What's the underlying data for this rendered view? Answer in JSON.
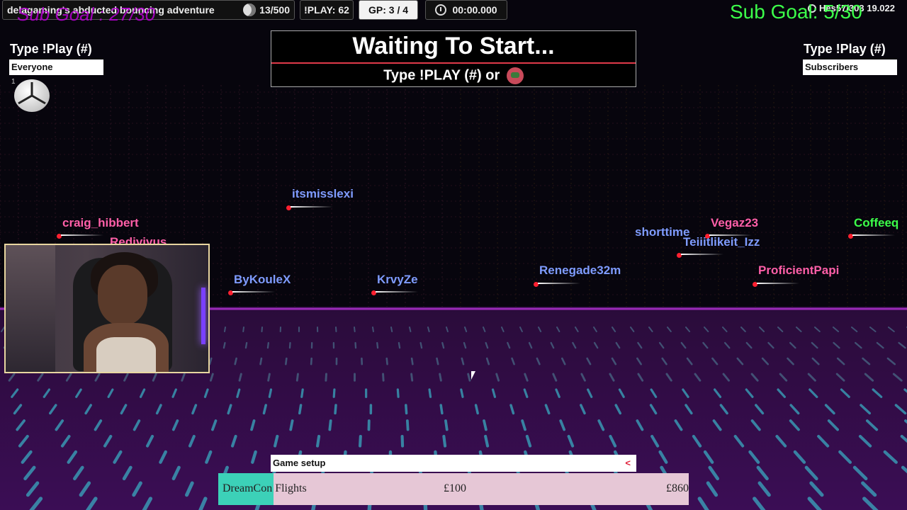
{
  "hud": {
    "title": "delagaming's abducted bouncing adventure",
    "count": "13/500",
    "play_count": "!PLAY: 62",
    "gp": "GP: 3 / 4",
    "timer": "00:00.000",
    "right_info": "Hes57/303 19.022"
  },
  "overlay": {
    "sub_goal_left": "Sub Goal : 27/30",
    "sub_goal_right": "Sub Goal: 5/30"
  },
  "left_panel": {
    "heading": "Type !Play (#)",
    "box": "Everyone",
    "slot_number": "1"
  },
  "right_panel": {
    "heading": "Type !Play (#)",
    "box": "Subscribers"
  },
  "banner": {
    "title": "Waiting To Start...",
    "subtitle": "Type !PLAY (#) or"
  },
  "players": [
    {
      "name": "itsmisslexi",
      "color": "#7f9cff"
    },
    {
      "name": "craig_hibbert",
      "color": "#ff5fa8"
    },
    {
      "name": "Redivivus",
      "color": "#ff5fa8"
    },
    {
      "name": "ByKouleX",
      "color": "#7f9cff"
    },
    {
      "name": "KrvyZe",
      "color": "#7f9cff"
    },
    {
      "name": "Renegade32m",
      "color": "#7f9cff"
    },
    {
      "name": "shorttime",
      "color": "#7f9cff"
    },
    {
      "name": "Vegaz23",
      "color": "#ff5fa8"
    },
    {
      "name": "Teiiitlikeit_Izz",
      "color": "#7f9cff"
    },
    {
      "name": "ProficientPapi",
      "color": "#ff5fa8"
    },
    {
      "name": "Coffeeq",
      "color": "#3cff4a"
    }
  ],
  "setup": {
    "label": "Game setup",
    "collapse": "<"
  },
  "ticker": {
    "name": "DreamCon Flights",
    "price1": "£100",
    "price2": "£860"
  },
  "colors": {
    "accent_red": "#e03a4a",
    "ticker_bg": "#e6c7d6",
    "ticker_accent": "#3cd1b8"
  }
}
